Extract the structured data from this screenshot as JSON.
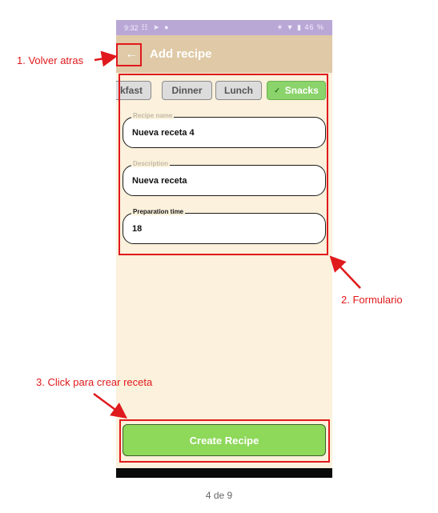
{
  "status_bar": {
    "time": "9:32",
    "left_icons": "☷ ➤ ●",
    "right_icons": "✶ ▼ ▮",
    "battery": "46 %"
  },
  "app_bar": {
    "back_icon": "←",
    "title": "Add recipe"
  },
  "chips": [
    {
      "label": "kfast",
      "selected": false
    },
    {
      "label": "Dinner",
      "selected": false
    },
    {
      "label": "Lunch",
      "selected": false
    },
    {
      "label": "Snacks",
      "selected": true
    }
  ],
  "chip_check": "✓",
  "form": {
    "recipe_name": {
      "label": "Recipe name",
      "value": "Nueva receta 4"
    },
    "description": {
      "label": "Description",
      "value": "Nueva receta"
    },
    "preparation_time": {
      "label": "Preparation time",
      "value": "18"
    }
  },
  "create_button": {
    "label": "Create Recipe"
  },
  "annotations": {
    "back": "1. Volver atras",
    "form": "2. Formulario",
    "create": "3. Click para crear receta"
  },
  "page_counter": "4 de 9",
  "colors": {
    "annotation_red": "#e0191c",
    "app_bar": "#dfc9a6",
    "status_bar": "#b9a8d6",
    "selected_chip": "#8bd36b",
    "create_button": "#8ed85a",
    "background": "#fbf1dc"
  }
}
